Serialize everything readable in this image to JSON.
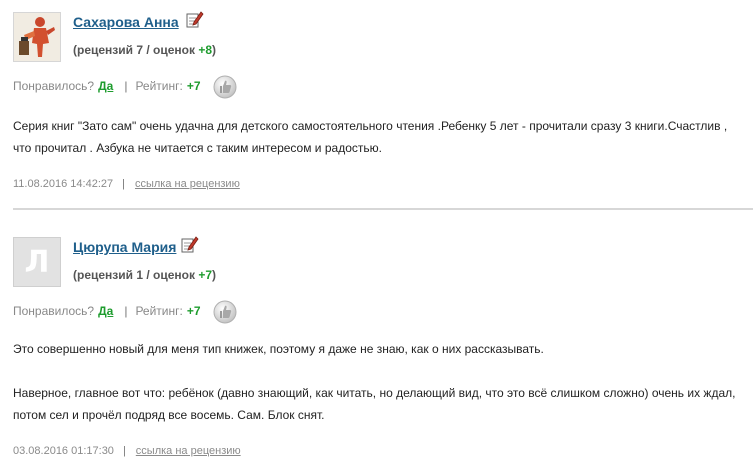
{
  "reviews": [
    {
      "author": "Сахарова Анна",
      "avatar": "photo-avatar",
      "counts": {
        "prefix": "(рецензий 7 / оценок ",
        "score": "+8",
        "suffix": ")"
      },
      "liked_label": "Понравилось?",
      "yes_label": "Да",
      "separator": "|",
      "rating_label": "Рейтинг:",
      "rating_value": "+7",
      "paragraphs": [
        "Серия книг \"Зато сам\" очень удачна для детского самостоятельного чтения .Ребенку 5 лет - прочитали сразу 3 книги.Счастлив , что прочитал . Азбука не читается с таким интересом и радостью."
      ],
      "date": "11.08.2016 14:42:27",
      "link_label": "ссылка на рецензию"
    },
    {
      "author": "Цюрупа Мария",
      "avatar_letter": "Л",
      "counts": {
        "prefix": "(рецензий 1 / оценок ",
        "score": "+7",
        "suffix": ")"
      },
      "liked_label": "Понравилось?",
      "yes_label": "Да",
      "separator": "|",
      "rating_label": "Рейтинг:",
      "rating_value": "+7",
      "paragraphs": [
        "Это совершенно новый для меня тип книжек, поэтому я даже не знаю, как о них рассказывать.",
        "Наверное, главное вот что: ребёнок (давно знающий, как читать, но делающий вид, что это всё слишком сложно) очень их ждал, потом сел и прочёл подряд все восемь. Сам. Блок снят."
      ],
      "date": "03.08.2016 01:17:30",
      "link_label": "ссылка на рецензию"
    }
  ],
  "colors": {
    "link": "#1f5f8b",
    "green": "#1e9c2e",
    "muted": "#8a8a8a",
    "divider": "#d7d7d7"
  },
  "icons": {
    "edit": "pencil-note-icon",
    "thumb": "thumbs-up-icon"
  }
}
